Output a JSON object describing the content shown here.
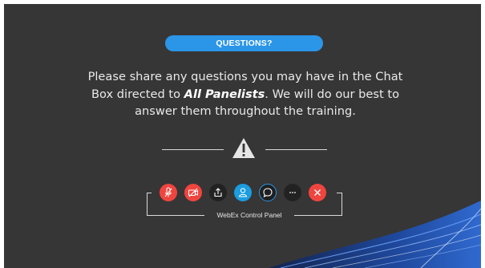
{
  "slide": {
    "banner": "QUESTIONS?",
    "message": {
      "before": "Please share any questions you may have in the Chat Box directed to ",
      "emphasis": "All Panelists",
      "after": ". We will do our best to answer them throughout the training."
    },
    "panel_label": "WebEx Control Panel"
  },
  "controls": [
    {
      "name": "mute-button",
      "icon": "microphone-off-icon",
      "color": "#f0453f"
    },
    {
      "name": "stop-video-button",
      "icon": "video-off-icon",
      "color": "#f0453f"
    },
    {
      "name": "share-button",
      "icon": "share-icon",
      "color": "#222222"
    },
    {
      "name": "participants-button",
      "icon": "participants-icon",
      "color": "#1b9de0"
    },
    {
      "name": "chat-button",
      "icon": "chat-icon",
      "color": "#1f1f1f"
    },
    {
      "name": "more-options-button",
      "icon": "ellipsis-icon",
      "color": "#222222"
    },
    {
      "name": "leave-button",
      "icon": "close-icon",
      "color": "#f0453f"
    }
  ],
  "colors": {
    "background": "#363636",
    "accent": "#2b95e8",
    "danger": "#f0453f",
    "text": "#e9e9e9"
  }
}
